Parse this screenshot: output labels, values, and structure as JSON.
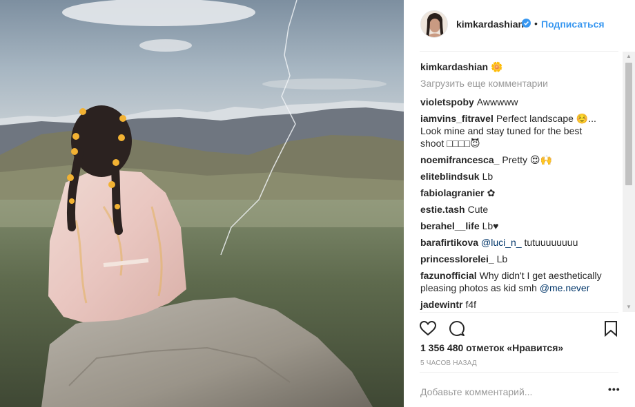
{
  "post": {
    "photo_description_icon": "photo-image",
    "header": {
      "username": "kimkardashian",
      "verified_icon": "verified-badge-icon",
      "separator": "•",
      "follow_label": "Подписаться"
    },
    "caption": {
      "username": "kimkardashian",
      "text": "🌼"
    },
    "load_more_label": "Загрузить еще комментарии",
    "comments": [
      {
        "user": "violetspoby",
        "text": "Awwwww"
      },
      {
        "user": "iamvins_fitravel",
        "text": "Perfect landscape ☺️... Look mine and stay tuned for the best shoot □□□□😈"
      },
      {
        "user": "noemifrancesca_",
        "text": "Pretty 😍🙌"
      },
      {
        "user": "eliteblindsuk",
        "text": "Lb"
      },
      {
        "user": "fabiolagranier",
        "text": "✿"
      },
      {
        "user": "estie.tash",
        "text": "Cute"
      },
      {
        "user": "berahel__life",
        "text": "Lb♥"
      },
      {
        "user": "barafirtikova",
        "mention": "@luci_n_",
        "text": "tutuuuuuuuu"
      },
      {
        "user": "princesslorelei_",
        "text": "Lb"
      },
      {
        "user": "fazunofficial",
        "text": "Why didn't I get aesthetically pleasing photos as kid smh",
        "mention": "@me.never"
      },
      {
        "user": "jadewintr",
        "text": "f4f"
      }
    ],
    "likes_label": "1 356 480 отметок «Нравится»",
    "timestamp": "5 часов назад",
    "add_comment_placeholder": "Добавьте комментарий...",
    "more_options_label": "•••",
    "icons": {
      "like": "heart-icon",
      "comment": "comment-bubble-icon",
      "save": "bookmark-icon",
      "scroll_up": "scroll-up-arrow-icon",
      "scroll_down": "scroll-down-arrow-icon"
    },
    "colors": {
      "accent_blue": "#3897f0",
      "mention": "#003569",
      "muted_text": "#999999",
      "text": "#262626"
    }
  }
}
